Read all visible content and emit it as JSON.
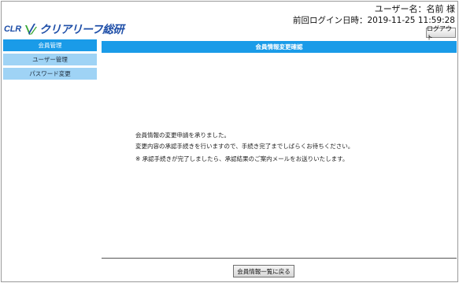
{
  "header": {
    "logo_prefix": "CLR",
    "logo_text": "クリアリーフ総研",
    "user_line": "ユーザー名：名前 様",
    "last_login": "前回ログイン日時：2019-11-25 11:59:28",
    "logout_label": "ログアウト"
  },
  "sidebar": {
    "items": [
      {
        "label": "会員管理",
        "active": true
      },
      {
        "label": "ユーザー管理",
        "active": false
      },
      {
        "label": "パスワード変更",
        "active": false
      }
    ]
  },
  "main": {
    "title": "会員情報変更確認",
    "message_line1": "会員情報の変更申請を承りました。",
    "message_line2": "変更内容の承認手続きを行いますので、手続き完了までしばらくお待ちください。",
    "message_line3": "※ 承認手続きが完了しましたら、承認結果のご案内メールをお送りいたします。",
    "back_label": "会員情報一覧に戻る"
  },
  "colors": {
    "accent": "#1a9be8",
    "sidebar_inactive": "#9fd3f5",
    "logo_blue": "#1f4fa8",
    "logo_green": "#3aa836"
  }
}
